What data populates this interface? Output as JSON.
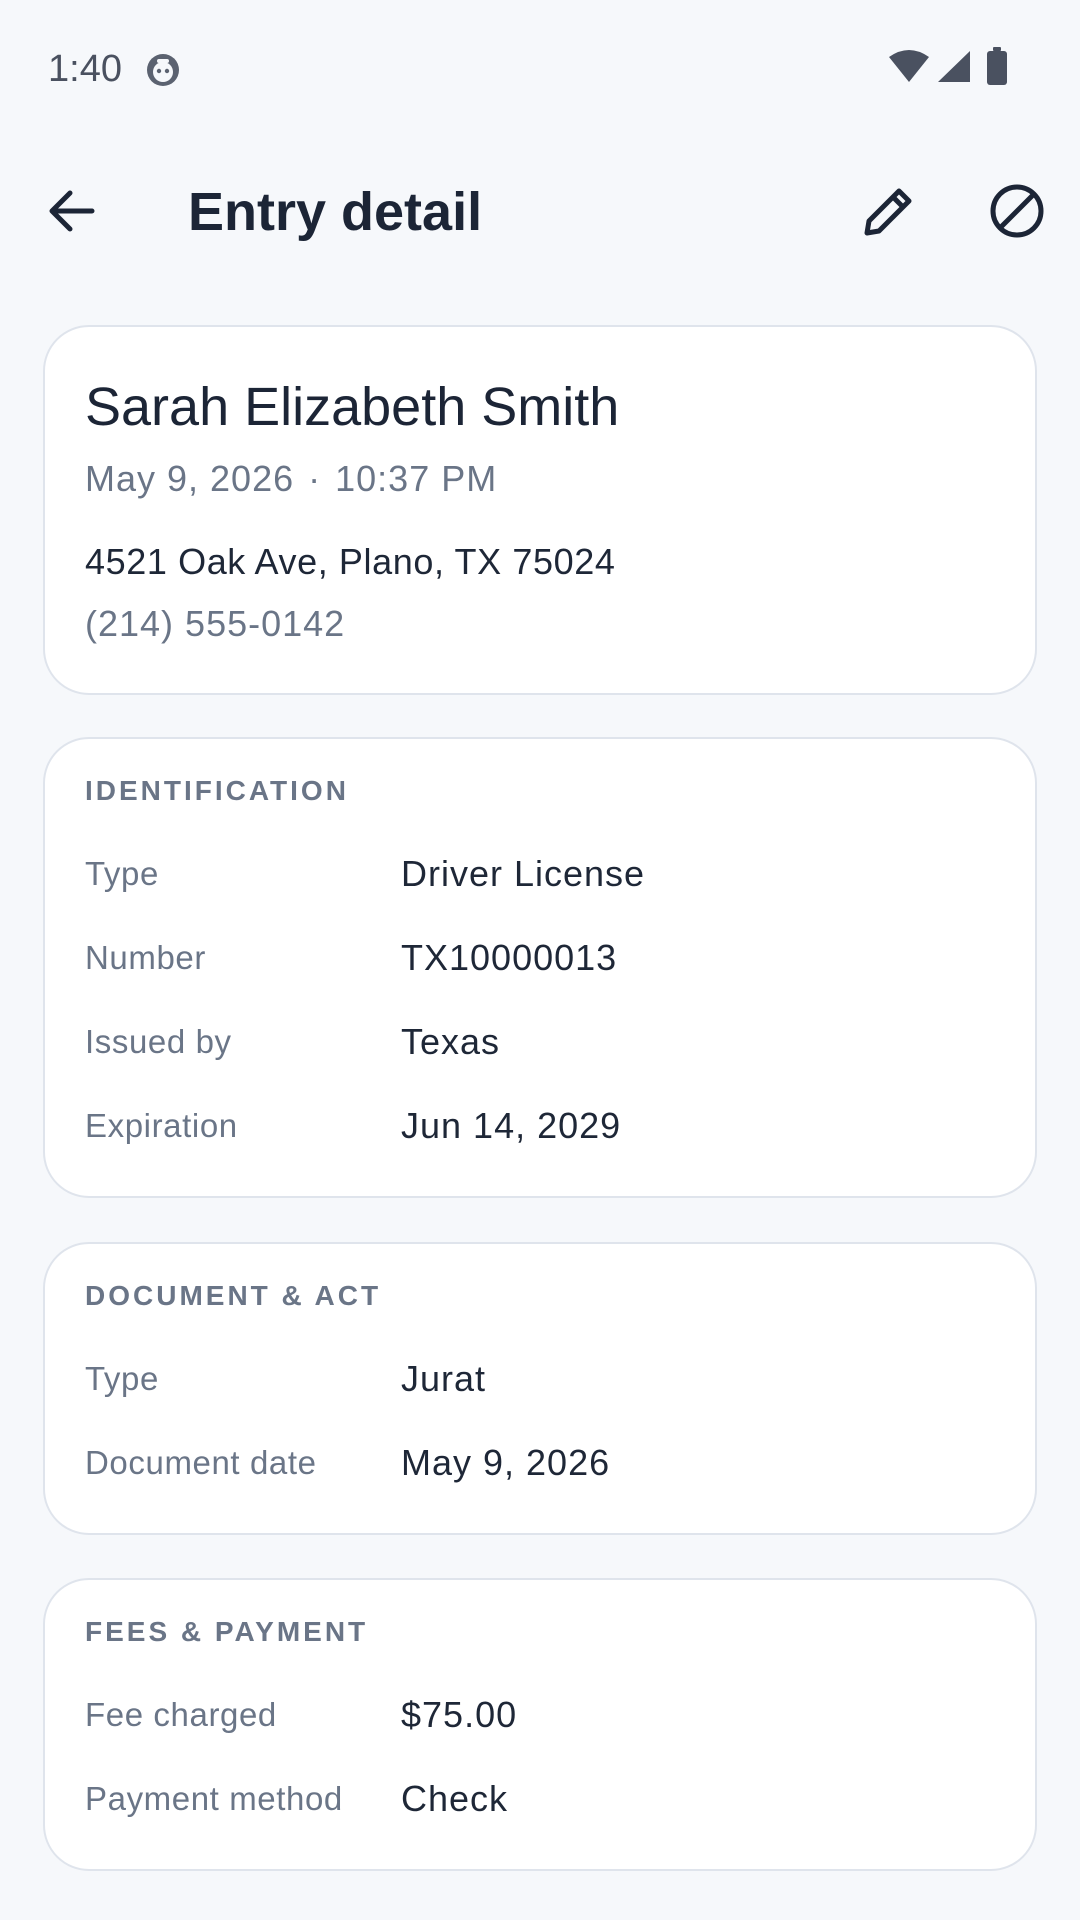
{
  "status_bar": {
    "time": "1:40",
    "app_icon": "notification-app-icon",
    "icons": [
      "wifi-icon",
      "signal-icon",
      "battery-icon"
    ]
  },
  "app_bar": {
    "title": "Entry detail",
    "back_icon": "arrow-left-icon",
    "edit_icon": "pencil-icon",
    "void_icon": "block-icon"
  },
  "entry": {
    "name": "Sarah Elizabeth Smith",
    "date": "May 9, 2026",
    "separator": "·",
    "time": "10:37 PM",
    "address": "4521 Oak Ave, Plano, TX 75024",
    "phone": "(214) 555-0142"
  },
  "identification": {
    "title": "IDENTIFICATION",
    "rows": [
      {
        "label": "Type",
        "value": "Driver License"
      },
      {
        "label": "Number",
        "value": "TX10000013"
      },
      {
        "label": "Issued by",
        "value": "Texas"
      },
      {
        "label": "Expiration",
        "value": "Jun 14, 2029"
      }
    ]
  },
  "document": {
    "title": "DOCUMENT & ACT",
    "rows": [
      {
        "label": "Type",
        "value": "Jurat"
      },
      {
        "label": "Document date",
        "value": "May 9, 2026"
      }
    ]
  },
  "fees": {
    "title": "FEES & PAYMENT",
    "rows": [
      {
        "label": "Fee charged",
        "value": "$75.00"
      },
      {
        "label": "Payment method",
        "value": "Check"
      }
    ]
  },
  "colors": {
    "background": "#f6f8fb",
    "card": "#ffffff",
    "card_border": "#dfe4ec",
    "text_primary": "#1e2737",
    "text_secondary": "#6a7587"
  }
}
